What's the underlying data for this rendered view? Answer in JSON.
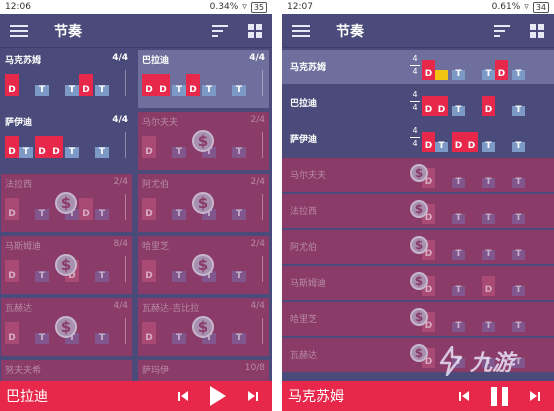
{
  "left": {
    "status": {
      "time": "12:06",
      "speed": "0.34",
      "speed_unit": "%",
      "battery": "35"
    },
    "title": "节奏",
    "now_playing": "巴拉迪",
    "cells": [
      {
        "name": "马克苏姆",
        "sig": "4/4",
        "state": "unlocked",
        "beats": [
          [
            "D"
          ],
          [
            "T"
          ],
          [
            "T",
            "D"
          ],
          [
            "T"
          ]
        ]
      },
      {
        "name": "巴拉迪",
        "sig": "4/4",
        "state": "selected",
        "beats": [
          [
            "D",
            "D"
          ],
          [
            "T",
            "D"
          ],
          [
            "T"
          ],
          [
            "T"
          ]
        ]
      },
      {
        "name": "萨伊迪",
        "sig": "4/4",
        "state": "unlocked",
        "beats": [
          [
            "D",
            "T"
          ],
          [
            "D",
            "D"
          ],
          [
            "T"
          ],
          [
            "T"
          ]
        ]
      },
      {
        "name": "马尔夫夫",
        "sig": "2/4",
        "state": "locked",
        "beats": [
          [
            "D"
          ],
          [
            "T"
          ],
          [
            "T"
          ],
          [
            "T"
          ]
        ]
      },
      {
        "name": "法拉西",
        "sig": "2/4",
        "state": "locked",
        "beats": [
          [
            "D"
          ],
          [
            "T"
          ],
          [
            "T",
            "D"
          ],
          [
            "T"
          ]
        ]
      },
      {
        "name": "阿尤伯",
        "sig": "2/4",
        "state": "locked",
        "beats": [
          [
            "D"
          ],
          [
            "T"
          ],
          [
            "T"
          ],
          [
            "T"
          ]
        ]
      },
      {
        "name": "马斯姆迪",
        "sig": "8/4",
        "state": "locked",
        "beats": [
          [
            "D"
          ],
          [
            "T"
          ],
          [
            "D"
          ],
          [
            "T"
          ]
        ]
      },
      {
        "name": "哈里芝",
        "sig": "2/4",
        "state": "locked",
        "beats": [
          [
            "D"
          ],
          [
            "T"
          ],
          [
            "T"
          ],
          [
            "T"
          ]
        ]
      },
      {
        "name": "瓦赫达",
        "sig": "4/4",
        "state": "locked",
        "beats": [
          [
            "D"
          ],
          [
            "T"
          ],
          [
            "T"
          ],
          [
            "T"
          ]
        ]
      },
      {
        "name": "瓦赫达-吉比拉",
        "sig": "4/4",
        "state": "locked",
        "beats": [
          [
            "D"
          ],
          [
            "T"
          ],
          [
            "T"
          ],
          [
            "T"
          ]
        ]
      },
      {
        "name": "努夫夫希",
        "sig": "",
        "state": "locked",
        "beats": []
      },
      {
        "name": "萨玛伊",
        "sig": "10/8",
        "state": "locked",
        "beats": []
      }
    ]
  },
  "right": {
    "status": {
      "time": "12:07",
      "speed": "0.61",
      "speed_unit": "%",
      "battery": "34"
    },
    "title": "节奏",
    "now_playing": "马克苏姆",
    "rows": [
      {
        "name": "马克苏姆",
        "sig_top": "4",
        "sig_bottom": "4",
        "state": "selected",
        "beats": [
          [
            "D",
            "Y"
          ],
          [
            "T"
          ],
          [
            "T",
            "D"
          ],
          [
            "T"
          ]
        ]
      },
      {
        "name": "巴拉迪",
        "sig_top": "4",
        "sig_bottom": "4",
        "state": "unlocked",
        "beats": [
          [
            "D",
            "D"
          ],
          [
            "T"
          ],
          [
            "D"
          ],
          [
            "T"
          ]
        ]
      },
      {
        "name": "萨伊迪",
        "sig_top": "4",
        "sig_bottom": "4",
        "state": "unlocked",
        "beats": [
          [
            "D",
            "T"
          ],
          [
            "D",
            "D"
          ],
          [
            "T"
          ],
          [
            "T"
          ]
        ]
      },
      {
        "name": "马尔夫夫",
        "state": "locked",
        "beats": [
          [
            "D"
          ],
          [
            "T"
          ],
          [
            "T"
          ],
          [
            "T"
          ]
        ]
      },
      {
        "name": "法拉西",
        "state": "locked",
        "beats": [
          [
            "D"
          ],
          [
            "T"
          ],
          [
            "T"
          ],
          [
            "T"
          ]
        ]
      },
      {
        "name": "阿尤伯",
        "state": "locked",
        "beats": [
          [
            "D"
          ],
          [
            "T"
          ],
          [
            "T"
          ],
          [
            "T"
          ]
        ]
      },
      {
        "name": "马斯姆迪",
        "state": "locked",
        "beats": [
          [
            "D"
          ],
          [
            "T"
          ],
          [
            "D"
          ],
          [
            "T"
          ]
        ]
      },
      {
        "name": "哈里芝",
        "state": "locked",
        "beats": [
          [
            "D"
          ],
          [
            "T"
          ],
          [
            "T"
          ],
          [
            "T"
          ]
        ]
      },
      {
        "name": "瓦赫达",
        "state": "locked",
        "beats": [
          [
            "D"
          ],
          [
            "T"
          ],
          [
            "T"
          ],
          [
            "T"
          ]
        ]
      }
    ]
  },
  "lock_symbol": "$",
  "watermark": "九游",
  "colors": {
    "bg": "#4a4b7a",
    "selected": "#6e6f9c",
    "locked": "#8a3b68",
    "accent": "#e8284a",
    "tek": "#7d99c6",
    "dum_highlight": "#f1c40f"
  }
}
